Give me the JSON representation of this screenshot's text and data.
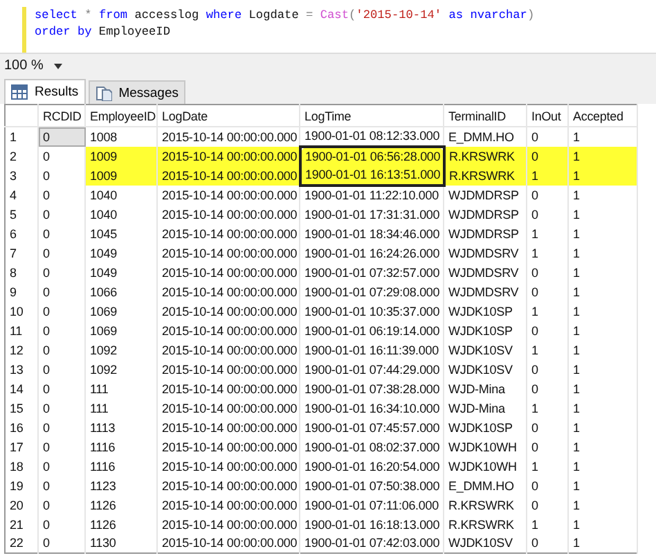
{
  "editor": {
    "lines": [
      [
        {
          "kind": "keyword",
          "text": "select"
        },
        {
          "kind": "operator",
          "text": " * "
        },
        {
          "kind": "keyword",
          "text": "from"
        },
        {
          "kind": "plain",
          "text": " accesslog "
        },
        {
          "kind": "keyword",
          "text": "where"
        },
        {
          "kind": "plain",
          "text": " Logdate "
        },
        {
          "kind": "operator",
          "text": "= "
        },
        {
          "kind": "function",
          "text": "Cast"
        },
        {
          "kind": "operator",
          "text": "("
        },
        {
          "kind": "string",
          "text": "'2015-10-14'"
        },
        {
          "kind": "keyword",
          "text": " as nvarchar"
        },
        {
          "kind": "operator",
          "text": ")"
        }
      ],
      [
        {
          "kind": "keyword",
          "text": "order by"
        },
        {
          "kind": "plain",
          "text": " EmployeeID"
        }
      ]
    ]
  },
  "zoom": {
    "value": "100 %"
  },
  "tabs": [
    {
      "label": "Results",
      "selected": true
    },
    {
      "label": "Messages",
      "selected": false
    }
  ],
  "grid": {
    "columns": [
      "RCDID",
      "EmployeeID",
      "LogDate",
      "LogTime",
      "TerminalID",
      "InOut",
      "Accepted"
    ],
    "rows": [
      {
        "num": "1",
        "cells": [
          "0",
          "1008",
          "2015-10-14 00:00:00.000",
          "1900-01-01 08:12:33.000",
          "E_DMM.HO",
          "0",
          "1"
        ],
        "selected": true,
        "highlighted": false,
        "circled": false
      },
      {
        "num": "2",
        "cells": [
          "0",
          "1009",
          "2015-10-14 00:00:00.000",
          "1900-01-01 06:56:28.000",
          "R.KRSWRK",
          "0",
          "1"
        ],
        "selected": false,
        "highlighted": true,
        "circled": true
      },
      {
        "num": "3",
        "cells": [
          "0",
          "1009",
          "2015-10-14 00:00:00.000",
          "1900-01-01 16:13:51.000",
          "R.KRSWRK",
          "1",
          "1"
        ],
        "selected": false,
        "highlighted": true,
        "circled": true
      },
      {
        "num": "4",
        "cells": [
          "0",
          "1040",
          "2015-10-14 00:00:00.000",
          "1900-01-01 11:22:10.000",
          "WJDMDRSP",
          "0",
          "1"
        ],
        "selected": false,
        "highlighted": false,
        "circled": false
      },
      {
        "num": "5",
        "cells": [
          "0",
          "1040",
          "2015-10-14 00:00:00.000",
          "1900-01-01 17:31:31.000",
          "WJDMDRSP",
          "0",
          "1"
        ],
        "selected": false,
        "highlighted": false,
        "circled": false
      },
      {
        "num": "6",
        "cells": [
          "0",
          "1045",
          "2015-10-14 00:00:00.000",
          "1900-01-01 18:34:46.000",
          "WJDMDRSP",
          "1",
          "1"
        ],
        "selected": false,
        "highlighted": false,
        "circled": false
      },
      {
        "num": "7",
        "cells": [
          "0",
          "1049",
          "2015-10-14 00:00:00.000",
          "1900-01-01 16:24:26.000",
          "WJDMDSRV",
          "1",
          "1"
        ],
        "selected": false,
        "highlighted": false,
        "circled": false
      },
      {
        "num": "8",
        "cells": [
          "0",
          "1049",
          "2015-10-14 00:00:00.000",
          "1900-01-01 07:32:57.000",
          "WJDMDSRV",
          "0",
          "1"
        ],
        "selected": false,
        "highlighted": false,
        "circled": false
      },
      {
        "num": "9",
        "cells": [
          "0",
          "1066",
          "2015-10-14 00:00:00.000",
          "1900-01-01 07:29:08.000",
          "WJDMDSRV",
          "0",
          "1"
        ],
        "selected": false,
        "highlighted": false,
        "circled": false
      },
      {
        "num": "10",
        "cells": [
          "0",
          "1069",
          "2015-10-14 00:00:00.000",
          "1900-01-01 10:35:37.000",
          "WJDK10SP",
          "1",
          "1"
        ],
        "selected": false,
        "highlighted": false,
        "circled": false
      },
      {
        "num": "11",
        "cells": [
          "0",
          "1069",
          "2015-10-14 00:00:00.000",
          "1900-01-01 06:19:14.000",
          "WJDK10SP",
          "0",
          "1"
        ],
        "selected": false,
        "highlighted": false,
        "circled": false
      },
      {
        "num": "12",
        "cells": [
          "0",
          "1092",
          "2015-10-14 00:00:00.000",
          "1900-01-01 16:11:39.000",
          "WJDK10SV",
          "1",
          "1"
        ],
        "selected": false,
        "highlighted": false,
        "circled": false
      },
      {
        "num": "13",
        "cells": [
          "0",
          "1092",
          "2015-10-14 00:00:00.000",
          "1900-01-01 07:44:29.000",
          "WJDK10SV",
          "0",
          "1"
        ],
        "selected": false,
        "highlighted": false,
        "circled": false
      },
      {
        "num": "14",
        "cells": [
          "0",
          "111",
          "2015-10-14 00:00:00.000",
          "1900-01-01 07:38:28.000",
          "WJD-Mina",
          "0",
          "1"
        ],
        "selected": false,
        "highlighted": false,
        "circled": false
      },
      {
        "num": "15",
        "cells": [
          "0",
          "111",
          "2015-10-14 00:00:00.000",
          "1900-01-01 16:34:10.000",
          "WJD-Mina",
          "1",
          "1"
        ],
        "selected": false,
        "highlighted": false,
        "circled": false
      },
      {
        "num": "16",
        "cells": [
          "0",
          "1113",
          "2015-10-14 00:00:00.000",
          "1900-01-01 07:45:57.000",
          "WJDK10SP",
          "0",
          "1"
        ],
        "selected": false,
        "highlighted": false,
        "circled": false
      },
      {
        "num": "17",
        "cells": [
          "0",
          "1116",
          "2015-10-14 00:00:00.000",
          "1900-01-01 08:02:37.000",
          "WJDK10WH",
          "0",
          "1"
        ],
        "selected": false,
        "highlighted": false,
        "circled": false
      },
      {
        "num": "18",
        "cells": [
          "0",
          "1116",
          "2015-10-14 00:00:00.000",
          "1900-01-01 16:20:54.000",
          "WJDK10WH",
          "1",
          "1"
        ],
        "selected": false,
        "highlighted": false,
        "circled": false
      },
      {
        "num": "19",
        "cells": [
          "0",
          "1123",
          "2015-10-14 00:00:00.000",
          "1900-01-01 07:50:38.000",
          "E_DMM.HO",
          "0",
          "1"
        ],
        "selected": false,
        "highlighted": false,
        "circled": false
      },
      {
        "num": "20",
        "cells": [
          "0",
          "1126",
          "2015-10-14 00:00:00.000",
          "1900-01-01 07:11:06.000",
          "R.KRSWRK",
          "0",
          "1"
        ],
        "selected": false,
        "highlighted": false,
        "circled": false
      },
      {
        "num": "21",
        "cells": [
          "0",
          "1126",
          "2015-10-14 00:00:00.000",
          "1900-01-01 16:18:13.000",
          "R.KRSWRK",
          "1",
          "1"
        ],
        "selected": false,
        "highlighted": false,
        "circled": false
      },
      {
        "num": "22",
        "cells": [
          "0",
          "1130",
          "2015-10-14 00:00:00.000",
          "1900-01-01 07:42:03.000",
          "WJDK10SV",
          "0",
          "1"
        ],
        "selected": false,
        "highlighted": false,
        "circled": false
      }
    ]
  }
}
